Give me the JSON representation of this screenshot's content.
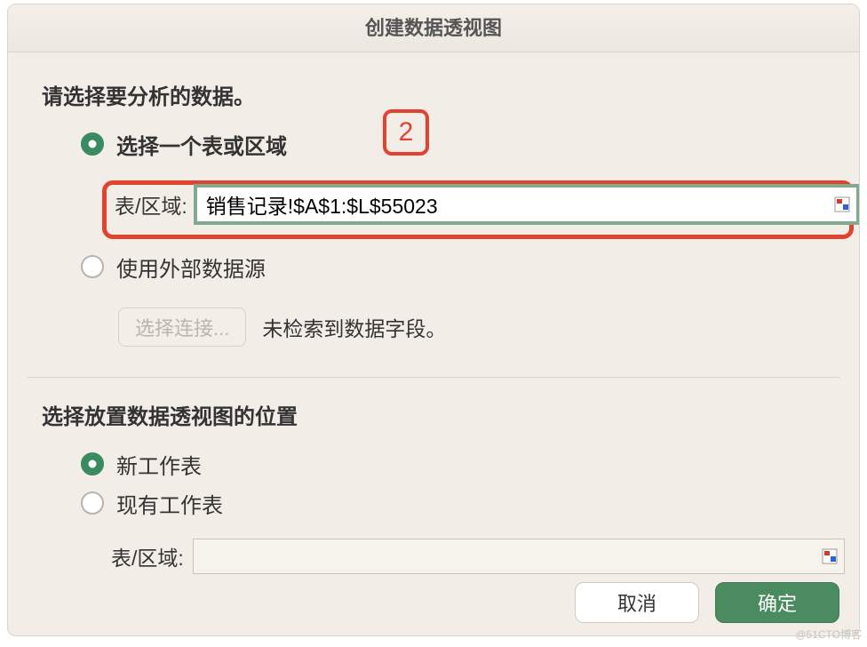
{
  "title": "创建数据透视图",
  "annotation": {
    "badge": "2"
  },
  "section1": {
    "heading": "请选择要分析的数据。",
    "opt_range": "选择一个表或区域",
    "range_label": "表/区域:",
    "range_value": "销售记录!$A$1:$L$55023",
    "opt_external": "使用外部数据源",
    "choose_connection_btn": "选择连接...",
    "no_fields_text": "未检索到数据字段。"
  },
  "section2": {
    "heading": "选择放置数据透视图的位置",
    "opt_newsheet": "新工作表",
    "opt_existing": "现有工作表",
    "range_label": "表/区域:",
    "range_value": ""
  },
  "footer": {
    "cancel": "取消",
    "ok": "确定"
  },
  "watermark": "@51CTO博客"
}
